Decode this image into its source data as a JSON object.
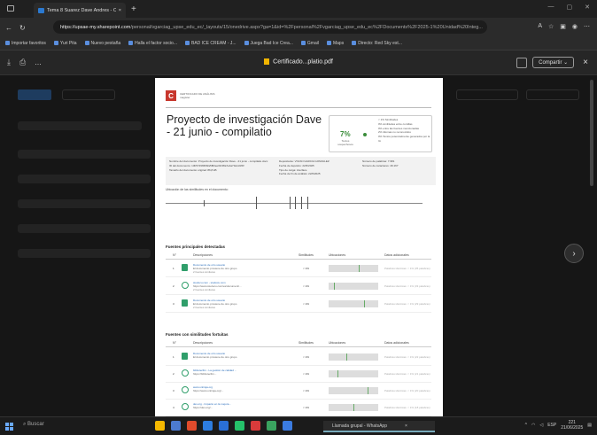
{
  "browser": {
    "tab_title": "Tema 8 Suarez Dave Andres - Co...",
    "url_host": "https://upsae-my.sharepoint.com",
    "url_path": "/personal/vgarciag_upse_edu_ec/_layouts/15/onedrive.aspx?ga=1&id=%2Fpersonal%2Fvgarciag_upse_edu_ec%2FDocuments%2F2025-1%20Unidad%20Integ...",
    "bookmarks": [
      "Importar favoritos",
      "Yuri Pita",
      "Nuevo pestaña",
      "Halla el factor socio...",
      "BAD ICE CREAM - J...",
      "Juega Bad Ice Crea...",
      "Gmail",
      "Maps",
      "Directo: Red Sky est..."
    ]
  },
  "viewer": {
    "toolbar_left": [
      "⤓",
      "⎙",
      "..."
    ],
    "file_name": "Certificado...platio.pdf",
    "share_label": "Compartir",
    "close": "×"
  },
  "document": {
    "header_line1": "CERTIFICADO DE ANÁLISIS",
    "header_line2": "magister",
    "title": "Proyecto de investigación Dave - 21 junio - compilatio",
    "similarity": {
      "percent": "7%",
      "label": "Textos sospechosos",
      "legend": [
        "< 1% Similitudes",
        "0% similitudes entre comillas",
        "0% entre las fuentes mencionadas",
        "2% Idiomas no reconocidos",
        "0% Textos potencialmente generados por la IA"
      ]
    },
    "meta_col1": [
      "Nombre del documento: Proyecto de investigación Dave - 21 junio - compilatio.docx",
      "ID del documento: 13b5749f0f0bfa5f82ee01f48a7e4a73a1d1f9f",
      "Tamaño del documento original: 86,8 kB"
    ],
    "meta_col2": [
      "Depositante: VIVIAN GARCIA GONZALEZ",
      "Fecha de depósito: 22/6/2025",
      "Tipo de carga: interface",
      "Fecha de fin de análisis: 22/6/2025"
    ],
    "meta_col3": [
      "Número de palabras: 7.981",
      "Número de caracteres: 49.167"
    ],
    "location_label": "Ubicación de las similitudes en el documento:",
    "section1": "Fuentes principales detectadas",
    "section2": "Fuentes con similitudes fortuitas",
    "columns": [
      "N°",
      "Descripciones",
      "Similitudes",
      "Ubicaciones",
      "Datos adicionales"
    ],
    "main_sources": [
      {
        "n": "1",
        "name": "Documento de otro usuario",
        "sub": "El documento proviene de otro grupo",
        "extra": "2 fuentes similares",
        "sim": "< 1%",
        "dt": "Palabras idénticas: < 1% (35 palabras)"
      },
      {
        "n": "2",
        "name": "studocu.com - studocu.com",
        "sub": "https://www.studocu.com/es/document/...",
        "extra": "2 fuentes similares",
        "sim": "< 1%",
        "dt": "Palabras idénticas: < 1% (33 palabras)"
      },
      {
        "n": "3",
        "name": "Documento de otro usuario",
        "sub": "El documento proviene de otro grupo",
        "extra": "2 fuentes similares",
        "sim": "< 1%",
        "dt": "Palabras idénticas: < 1% (29 palabras)"
      }
    ],
    "fortuitous_sources": [
      {
        "n": "1",
        "name": "Documento de otro usuario",
        "sub": "El documento proviene de otro grupo",
        "sim": "< 1%",
        "dt": "Palabras idénticas: < 1% (22 palabras)"
      },
      {
        "n": "2",
        "name": "bibliotecllm - La gestión de calidad ...",
        "sub": "https://bibliotecllm...",
        "sim": "< 1%",
        "dt": "Palabras idénticas: < 1% (21 palabras)"
      },
      {
        "n": "3",
        "name": "www.unirioja.org",
        "sub": "https://www.unirioja.org/...",
        "sim": "< 1%",
        "dt": "Palabras idénticas: < 1% (20 palabras)"
      },
      {
        "n": "4",
        "name": "dev.org - Impacto en la mejora...",
        "sub": "https://dev.org/...",
        "sim": "< 1%",
        "dt": "Palabras idénticas: < 1% (18 palabras)"
      }
    ]
  },
  "taskbar": {
    "search": "Buscar",
    "whatsapp": "Llamada grupal - WhatsApp",
    "lang": "ESP",
    "time": "221",
    "date": "21/06/2025"
  }
}
